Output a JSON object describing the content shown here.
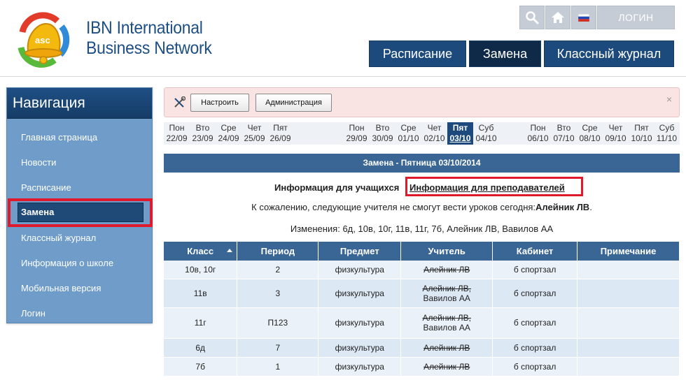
{
  "brand": {
    "line1": "IBN International",
    "line2": "Business Network",
    "logo_text": "asc"
  },
  "top_buttons": {
    "search": "search-icon",
    "home": "home-icon",
    "lang": "russia-flag-icon",
    "login_label": "ЛОГИН"
  },
  "main_tabs": [
    "Расписание",
    "Замена",
    "Классный журнал"
  ],
  "sidebar": {
    "title": "Навигация",
    "items": [
      "Главная страница",
      "Новости",
      "Расписание",
      "Замена",
      "Классный журнал",
      "Информация о школе",
      "Мобильная версия",
      "Логин"
    ]
  },
  "toolbar": {
    "configure": "Настроить",
    "admin": "Администрация",
    "close": "×"
  },
  "days": [
    {
      "name": "Пон",
      "date": "22/09"
    },
    {
      "name": "Вто",
      "date": "23/09"
    },
    {
      "name": "Сре",
      "date": "24/09"
    },
    {
      "name": "Чет",
      "date": "25/09"
    },
    {
      "name": "Пят",
      "date": "26/09"
    },
    {
      "name": "Пон",
      "date": "29/09"
    },
    {
      "name": "Вто",
      "date": "30/09"
    },
    {
      "name": "Сре",
      "date": "01/10"
    },
    {
      "name": "Чет",
      "date": "02/10"
    },
    {
      "name": "Пят",
      "date": "03/10"
    },
    {
      "name": "Суб",
      "date": "04/10"
    },
    {
      "name": "Пон",
      "date": "06/10"
    },
    {
      "name": "Вто",
      "date": "07/10"
    },
    {
      "name": "Сре",
      "date": "08/10"
    },
    {
      "name": "Чет",
      "date": "09/10"
    },
    {
      "name": "Пят",
      "date": "10/10"
    },
    {
      "name": "Суб",
      "date": "11/10"
    }
  ],
  "title": "Замена - Пятница 03/10/2014",
  "info": {
    "students": "Информация для учащихся",
    "teachers": "Информация для преподавателей"
  },
  "absent": {
    "text": "К сожалению, следующие учителя не смогут вести уроков сегодня:",
    "names": "Алейник ЛВ",
    "end": "."
  },
  "changes": "Изменения: 6д, 10в, 10г, 11в, 11г, 7б, Алейник ЛВ, Вавилов АА",
  "table": {
    "headers": [
      "Класс",
      "Период",
      "Предмет",
      "Учитель",
      "Кабинет",
      "Примечание"
    ],
    "rows": [
      {
        "class": "10в, 10г",
        "period": "2",
        "subject": "физкультура",
        "teacher_struck": "Алейник ЛВ",
        "teacher_new": "",
        "room": "б спортзал",
        "note": ""
      },
      {
        "class": "11в",
        "period": "3",
        "subject": "физкультура",
        "teacher_struck": "Алейник ЛВ,",
        "teacher_new": "Вавилов АА",
        "room": "б спортзал",
        "note": ""
      },
      {
        "class": "11г",
        "period": "П123",
        "subject": "физкультура",
        "teacher_struck": "Алейник ЛВ,",
        "teacher_new": "Вавилов АА",
        "room": "б спортзал",
        "note": ""
      },
      {
        "class": "6д",
        "period": "7",
        "subject": "физкультура",
        "teacher_struck": "Алейник ЛВ",
        "teacher_new": "",
        "room": "б спортзал",
        "note": ""
      },
      {
        "class": "7б",
        "period": "1",
        "subject": "физкультура",
        "teacher_struck": "Алейник ЛВ",
        "teacher_new": "",
        "room": "б спортзал",
        "note": ""
      }
    ]
  }
}
